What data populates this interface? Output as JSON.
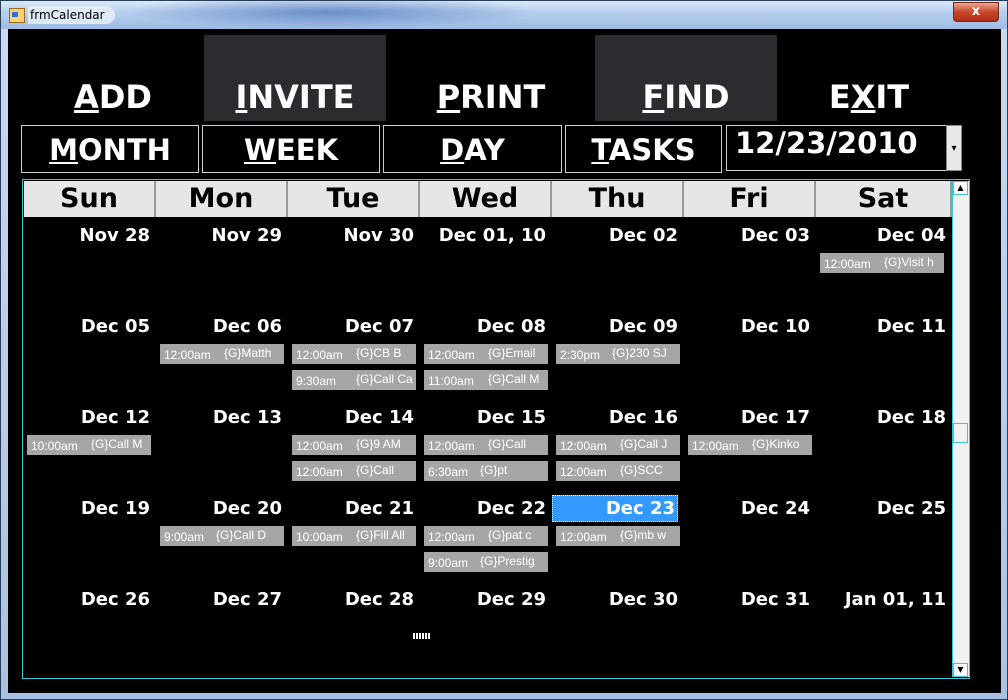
{
  "window": {
    "title": "frmCalendar",
    "close_glyph": "x"
  },
  "toolbar": {
    "add": {
      "hot": "A",
      "rest": "DD"
    },
    "invite": {
      "hot": "I",
      "rest": "NVITE"
    },
    "print": {
      "hot": "P",
      "rest": "RINT"
    },
    "find": {
      "hot": "F",
      "rest": "IND"
    },
    "exit": {
      "pre": "E",
      "hot": "X",
      "rest": "IT"
    }
  },
  "views": {
    "month": {
      "hot": "M",
      "rest": "ONTH"
    },
    "week": {
      "hot": "W",
      "rest": "EEK"
    },
    "day": {
      "hot": "D",
      "rest": "AY"
    },
    "tasks": {
      "hot": "T",
      "rest": "ASKS"
    }
  },
  "date_picker": {
    "value": "12/23/2010",
    "dropdown_glyph": "▾"
  },
  "calendar": {
    "weekdays": [
      "Sun",
      "Mon",
      "Tue",
      "Wed",
      "Thu",
      "Fri",
      "Sat"
    ],
    "weeks": [
      [
        "Nov 28",
        "Nov 29",
        "Nov 30",
        "Dec 01, 10",
        "Dec 02",
        "Dec 03",
        "Dec 04"
      ],
      [
        "Dec 05",
        "Dec 06",
        "Dec 07",
        "Dec 08",
        "Dec 09",
        "Dec 10",
        "Dec 11"
      ],
      [
        "Dec 12",
        "Dec 13",
        "Dec 14",
        "Dec 15",
        "Dec 16",
        "Dec 17",
        "Dec 18"
      ],
      [
        "Dec 19",
        "Dec 20",
        "Dec 21",
        "Dec 22",
        "Dec 23",
        "Dec 24",
        "Dec 25"
      ],
      [
        "Dec 26",
        "Dec 27",
        "Dec 28",
        "Dec 29",
        "Dec 30",
        "Dec 31",
        "Jan 01, 11"
      ]
    ],
    "today_label": "Dec 23",
    "events": {
      "dec04": [
        {
          "time": "12:00am",
          "desc": "{G}Visit h"
        }
      ],
      "dec06": [
        {
          "time": "12:00am",
          "desc": "{G}Matth"
        }
      ],
      "dec07": [
        {
          "time": "12:00am",
          "desc": "{G}CB B"
        },
        {
          "time": "9:30am",
          "desc": "{G}Call Ca"
        }
      ],
      "dec08": [
        {
          "time": "12:00am",
          "desc": "{G}Email"
        },
        {
          "time": "11:00am",
          "desc": "{G}Call M"
        }
      ],
      "dec09": [
        {
          "time": "2:30pm",
          "desc": "{G}230  SJ"
        }
      ],
      "dec12": [
        {
          "time": "10:00am",
          "desc": "{G}Call M"
        }
      ],
      "dec14": [
        {
          "time": "12:00am",
          "desc": "{G}9 AM"
        },
        {
          "time": "12:00am",
          "desc": "{G}Call"
        }
      ],
      "dec15": [
        {
          "time": "12:00am",
          "desc": "{G}Call"
        },
        {
          "time": "6:30am",
          "desc": "{G}pt"
        }
      ],
      "dec16": [
        {
          "time": "12:00am",
          "desc": "{G}Call J"
        },
        {
          "time": "12:00am",
          "desc": "{G}SCC"
        }
      ],
      "dec17": [
        {
          "time": "12:00am",
          "desc": "{G}Kinko"
        }
      ],
      "dec20": [
        {
          "time": "9:00am",
          "desc": "{G}Call D"
        }
      ],
      "dec21": [
        {
          "time": "10:00am",
          "desc": "{G}Fill All"
        }
      ],
      "dec22": [
        {
          "time": "12:00am",
          "desc": "{G}pat c"
        },
        {
          "time": "9:00am",
          "desc": "{G}Prestig"
        }
      ],
      "dec23": [
        {
          "time": "12:00am",
          "desc": "{G}mb w"
        }
      ]
    }
  },
  "scrollbar": {
    "up_glyph": "▲",
    "down_glyph": "▼"
  },
  "colors": {
    "background": "#000000",
    "header_bg": "#e6e6e6",
    "event_bg": "#a6a6a6",
    "today_bg": "#3399ff",
    "grid_border": "#39c7d6",
    "highlight_button": "#2b2b30"
  }
}
